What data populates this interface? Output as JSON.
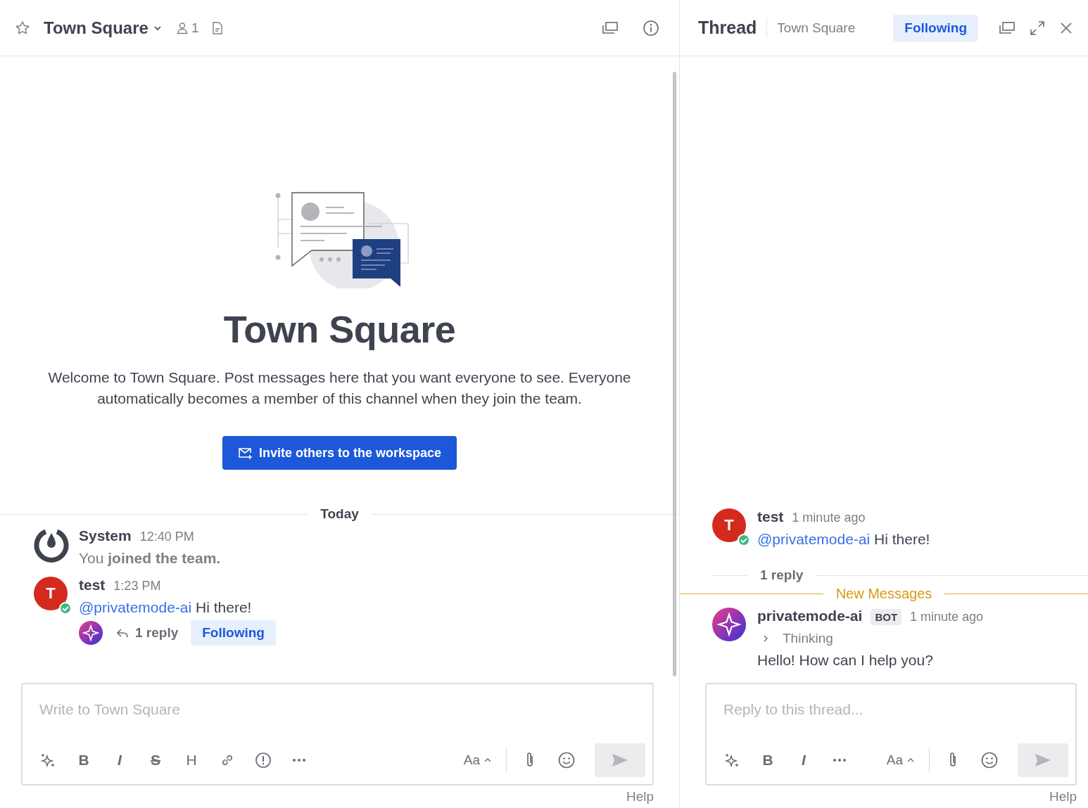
{
  "channel_header": {
    "title": "Town Square",
    "favorite": false,
    "member_count": "1"
  },
  "intro": {
    "title": "Town Square",
    "description": "Welcome to Town Square. Post messages here that you want everyone to see. Everyone automatically becomes a member of this channel when they join the team.",
    "invite_button": "Invite others to the workspace"
  },
  "date_separator": "Today",
  "posts": [
    {
      "kind": "system",
      "author": "System",
      "time": "12:40 PM",
      "text": "You **joined the team.**"
    },
    {
      "kind": "user",
      "author": "test",
      "avatar_letter": "T",
      "online": true,
      "time": "1:23 PM",
      "mention": "@privatemode-ai",
      "text": "Hi there!",
      "thread": {
        "replies": "1 reply",
        "follow": "Following",
        "following": true
      }
    }
  ],
  "composer": {
    "placeholder": "Write to Town Square",
    "tools": [
      {
        "kind": "ai"
      },
      {
        "kind": "bold",
        "label": "B"
      },
      {
        "kind": "italic",
        "label": "I"
      },
      {
        "kind": "strike",
        "label": "S"
      },
      {
        "kind": "heading",
        "label": "H"
      },
      {
        "kind": "link"
      },
      {
        "kind": "priority"
      },
      {
        "kind": "more"
      }
    ],
    "format_label": "Aa",
    "help": "Help"
  },
  "thread": {
    "title": "Thread",
    "channel": "Town Square",
    "follow": "Following",
    "following": true,
    "root": {
      "author": "test",
      "avatar_letter": "T",
      "online": true,
      "time": "1 minute ago",
      "mention": "@privatemode-ai",
      "text": "Hi there!"
    },
    "reply_count": "1 reply",
    "new_messages": "New Messages",
    "reply": {
      "author": "privatemode-ai",
      "badge": "BOT",
      "time": "1 minute ago",
      "thinking": {
        "label": "Thinking",
        "expanded": false
      },
      "text": "Hello! How can I help you?"
    },
    "composer": {
      "placeholder": "Reply to this thread...",
      "tools": [
        {
          "kind": "ai"
        },
        {
          "kind": "bold",
          "label": "B"
        },
        {
          "kind": "italic",
          "label": "I"
        },
        {
          "kind": "more"
        }
      ],
      "format_label": "Aa",
      "help": "Help"
    }
  }
}
